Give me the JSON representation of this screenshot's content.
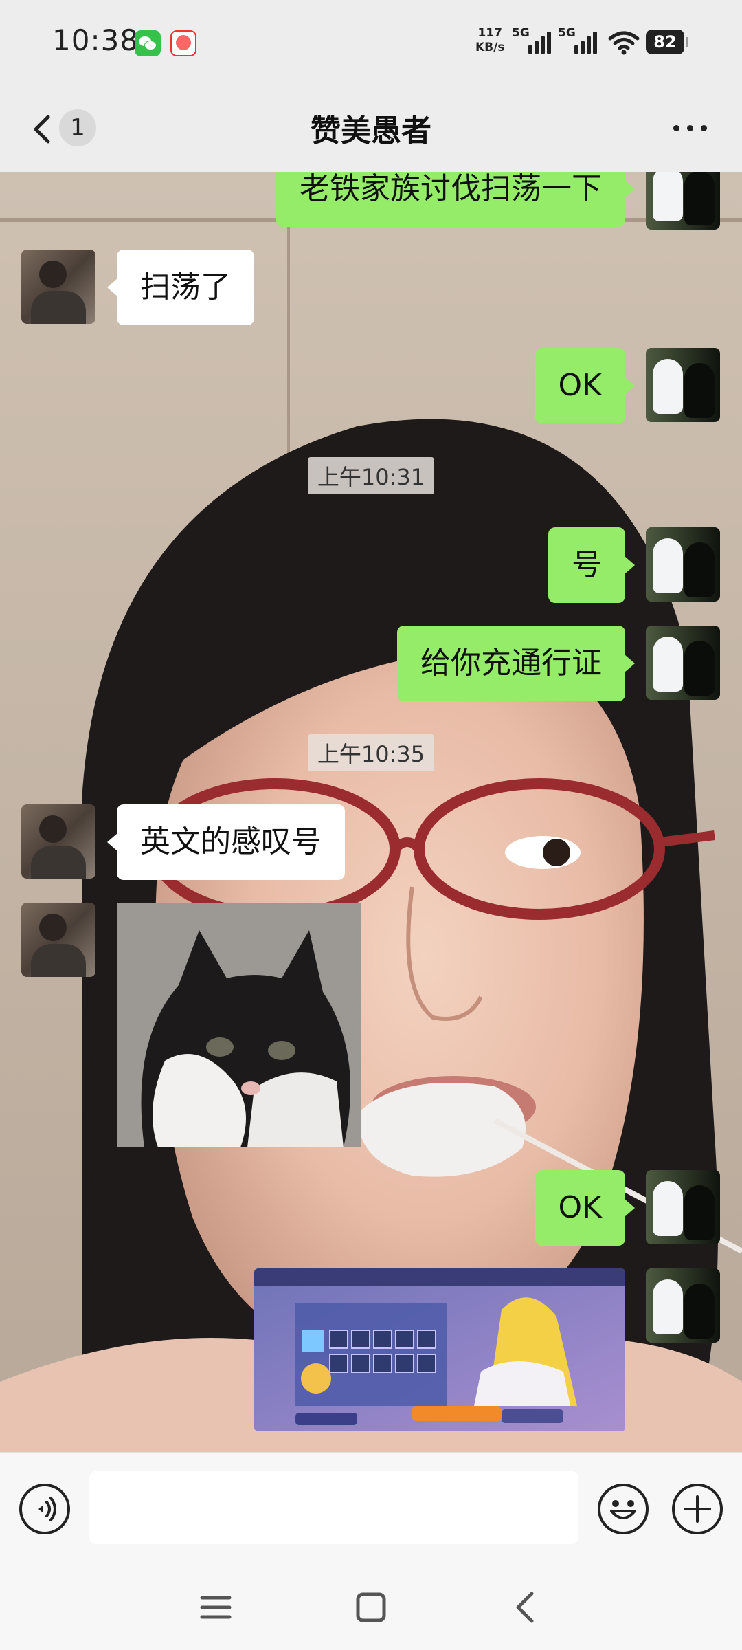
{
  "status_bar": {
    "time": "10:38",
    "net_speed_value": "117",
    "net_speed_unit": "KB/s",
    "signal_1_label": "5G",
    "signal_2_label": "5G",
    "battery": "82",
    "notification_icons": [
      "wechat-icon",
      "clown-icon"
    ]
  },
  "header": {
    "unread_count": "1",
    "title": "赞美愚者"
  },
  "messages": [
    {
      "from": "self",
      "type": "text",
      "text": "老铁家族讨伐扫荡一下"
    },
    {
      "from": "other",
      "type": "text",
      "text": "扫荡了"
    },
    {
      "from": "self",
      "type": "text",
      "text": "OK"
    },
    {
      "type": "time",
      "text": "上午10:31"
    },
    {
      "from": "self",
      "type": "text",
      "text": "号"
    },
    {
      "from": "self",
      "type": "text",
      "text": "给你充通行证"
    },
    {
      "type": "time",
      "text": "上午10:35"
    },
    {
      "from": "other",
      "type": "text",
      "text": "英文的感叹号"
    },
    {
      "from": "other",
      "type": "image",
      "image": "cat-photo"
    },
    {
      "from": "self",
      "type": "text",
      "text": "OK"
    },
    {
      "from": "self",
      "type": "image",
      "image": "game-screenshot"
    }
  ],
  "input_bar": {
    "placeholder": "",
    "icons": [
      "voice-icon",
      "emoji-icon",
      "plus-icon"
    ]
  },
  "colors": {
    "self_bubble": "#95ec69",
    "other_bubble": "#ffffff",
    "header_bg": "#ededed"
  }
}
